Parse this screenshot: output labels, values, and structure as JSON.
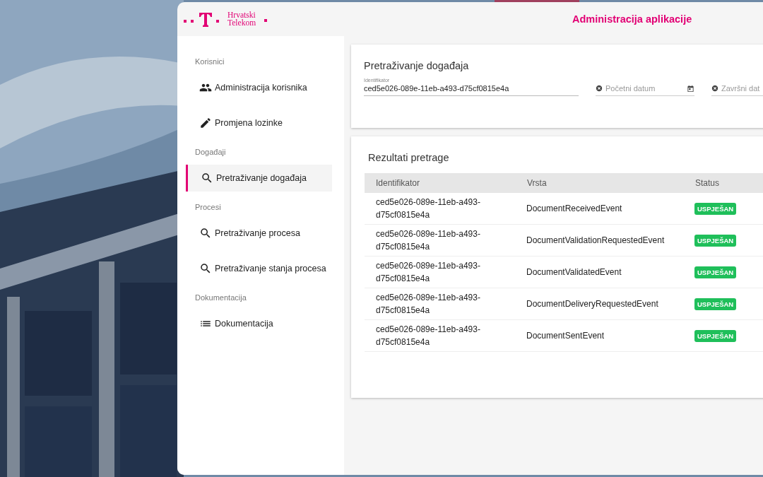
{
  "header": {
    "brand": "Hrvatski Telekom",
    "title": "Administracija aplikacije"
  },
  "sidebar": {
    "sections": [
      {
        "title": "Korisnici",
        "items": [
          {
            "label": "Administracija korisnika",
            "kind": "users",
            "selected": false
          },
          {
            "label": "Promjena lozinke",
            "kind": "edit",
            "selected": false
          }
        ]
      },
      {
        "title": "Događaji",
        "items": [
          {
            "label": "Pretraživanje događaja",
            "kind": "search",
            "selected": true
          }
        ]
      },
      {
        "title": "Procesi",
        "items": [
          {
            "label": "Pretraživanje procesa",
            "kind": "search",
            "selected": false
          },
          {
            "label": "Pretraživanje stanja procesa",
            "kind": "search",
            "selected": false
          }
        ]
      },
      {
        "title": "Dokumentacija",
        "items": [
          {
            "label": "Dokumentacija",
            "kind": "list",
            "selected": false
          }
        ]
      }
    ]
  },
  "search": {
    "title": "Pretraživanje događaja",
    "identifier": {
      "label": "Identifikator",
      "value": "ced5e026-089e-11eb-a493-d75cf0815e4a"
    },
    "date_fields": [
      {
        "placeholder": "Početni datum",
        "calendar": true
      },
      {
        "placeholder": "Završni dat"
      }
    ]
  },
  "results": {
    "title": "Rezultati pretrage",
    "columns": [
      "Identifikator",
      "Vrsta",
      "Status"
    ],
    "rows": [
      {
        "id": "ced5e026-089e-11eb-a493-d75cf0815e4a",
        "type": "DocumentReceivedEvent",
        "status": "USPJEŠAN",
        "color": "#1fbf5a"
      },
      {
        "id": "ced5e026-089e-11eb-a493-d75cf0815e4a",
        "type": "DocumentValidationRequestedEvent",
        "status": "USPJEŠAN",
        "color": "#1fbf5a"
      },
      {
        "id": "ced5e026-089e-11eb-a493-d75cf0815e4a",
        "type": "DocumentValidatedEvent",
        "status": "USPJEŠAN",
        "color": "#1fbf5a"
      },
      {
        "id": "ced5e026-089e-11eb-a493-d75cf0815e4a",
        "type": "DocumentDeliveryRequestedEvent",
        "status": "USPJEŠAN",
        "color": "#1fbf5a"
      },
      {
        "id": "ced5e026-089e-11eb-a493-d75cf0815e4a",
        "type": "DocumentSentEvent",
        "status": "USPJEŠAN",
        "color": "#1fbf5a"
      }
    ]
  }
}
